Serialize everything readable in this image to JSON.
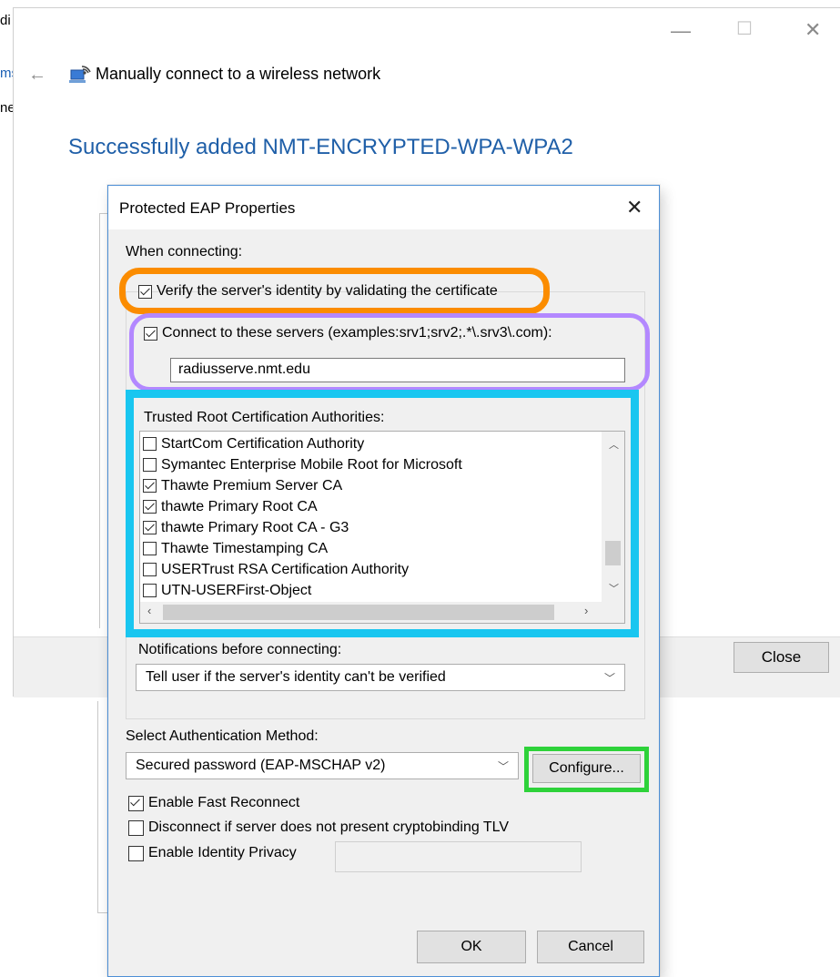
{
  "background_window": {
    "left_fragments": [
      "di",
      "ms",
      "ne"
    ],
    "nav_title": "Manually connect to a wireless network",
    "heading": "Successfully added NMT-ENCRYPTED-WPA-WPA2",
    "close_label": "Close",
    "controls": {
      "minimize": "—",
      "maximize": "☐",
      "close": "✕"
    }
  },
  "dialog": {
    "title": "Protected EAP Properties",
    "close_glyph": "✕",
    "when_connecting": "When connecting:",
    "verify_label": "Verify the server's identity by validating the certificate",
    "verify_checked": true,
    "connect_label": "Connect to these servers (examples:srv1;srv2;.*\\.srv3\\.com):",
    "connect_checked": true,
    "servers_value": "radiusserve.nmt.edu",
    "trusted_root_label": "Trusted Root Certification Authorities:",
    "cert_list": [
      {
        "name": "StartCom Certification Authority",
        "checked": false
      },
      {
        "name": "Symantec Enterprise Mobile Root for Microsoft",
        "checked": false
      },
      {
        "name": "Thawte Premium Server CA",
        "checked": true
      },
      {
        "name": "thawte Primary Root CA",
        "checked": true
      },
      {
        "name": "thawte Primary Root CA - G3",
        "checked": true
      },
      {
        "name": "Thawte Timestamping CA",
        "checked": false
      },
      {
        "name": "USERTrust RSA Certification Authority",
        "checked": false
      },
      {
        "name": "UTN-USERFirst-Object",
        "checked": false
      }
    ],
    "notifications_label": "Notifications before connecting:",
    "notifications_value": "Tell user if the server's identity can't be verified",
    "auth_method_label": "Select Authentication Method:",
    "auth_method_value": "Secured password (EAP-MSCHAP v2)",
    "configure_label": "Configure...",
    "fast_reconnect_label": "Enable Fast Reconnect",
    "fast_reconnect_checked": true,
    "cryptobinding_label": "Disconnect if server does not present cryptobinding TLV",
    "cryptobinding_checked": false,
    "identity_privacy_label": "Enable Identity Privacy",
    "identity_privacy_checked": false,
    "identity_privacy_value": "",
    "ok_label": "OK",
    "cancel_label": "Cancel"
  },
  "highlight_colors": {
    "orange": "#fb8c00",
    "purple": "#b388ff",
    "cyan": "#19c6f0",
    "green": "#2ed23a"
  }
}
